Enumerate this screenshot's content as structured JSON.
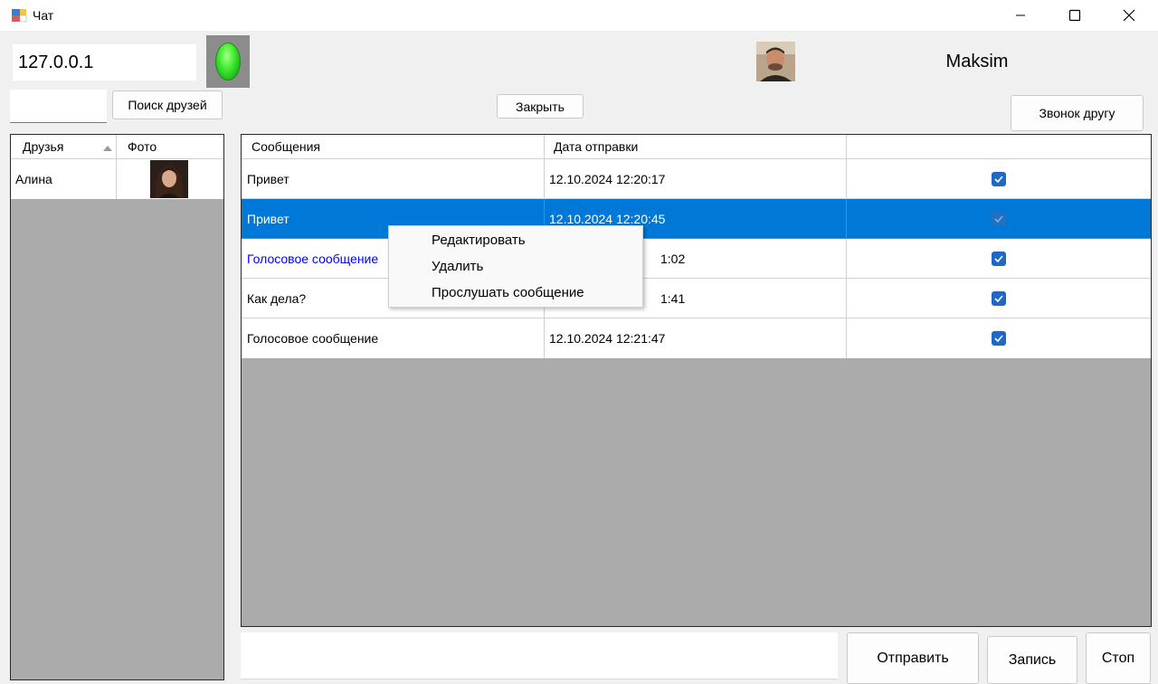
{
  "window": {
    "title": "Чат"
  },
  "connection": {
    "ip": "127.0.0.1"
  },
  "user": {
    "name": "Maksim"
  },
  "toolbar": {
    "search_friends_label": "Поиск друзей",
    "close_label": "Закрыть",
    "call_label": "Звонок другу"
  },
  "friends": {
    "columns": [
      "Друзья",
      "Фото"
    ],
    "rows": [
      {
        "name": "Алина"
      }
    ]
  },
  "messages": {
    "columns": [
      "Сообщения",
      "Дата отправки",
      ""
    ],
    "rows": [
      {
        "text": "Привет",
        "date": "12.10.2024 12:20:17",
        "checked": true
      },
      {
        "text": "Привет",
        "date": "12.10.2024 12:20:45",
        "checked": true,
        "selected": true
      },
      {
        "text": "Голосовое сообщение",
        "date": "1:02",
        "checked": true,
        "link": true
      },
      {
        "text": "Как дела?",
        "date": "1:41",
        "checked": true
      },
      {
        "text": "Голосовое сообщение",
        "date": "12.10.2024 12:21:47",
        "checked": true
      }
    ]
  },
  "context_menu": {
    "items": [
      "Редактировать",
      "Удалить",
      "Прослушать сообщение"
    ]
  },
  "bottom": {
    "send_label": "Отправить",
    "record_label": "Запись",
    "stop_label": "Стоп"
  },
  "colors": {
    "selection": "#0078d7",
    "checkbox": "#1f68c4",
    "link": "#0000ff",
    "status_led": "#3ee32f"
  }
}
